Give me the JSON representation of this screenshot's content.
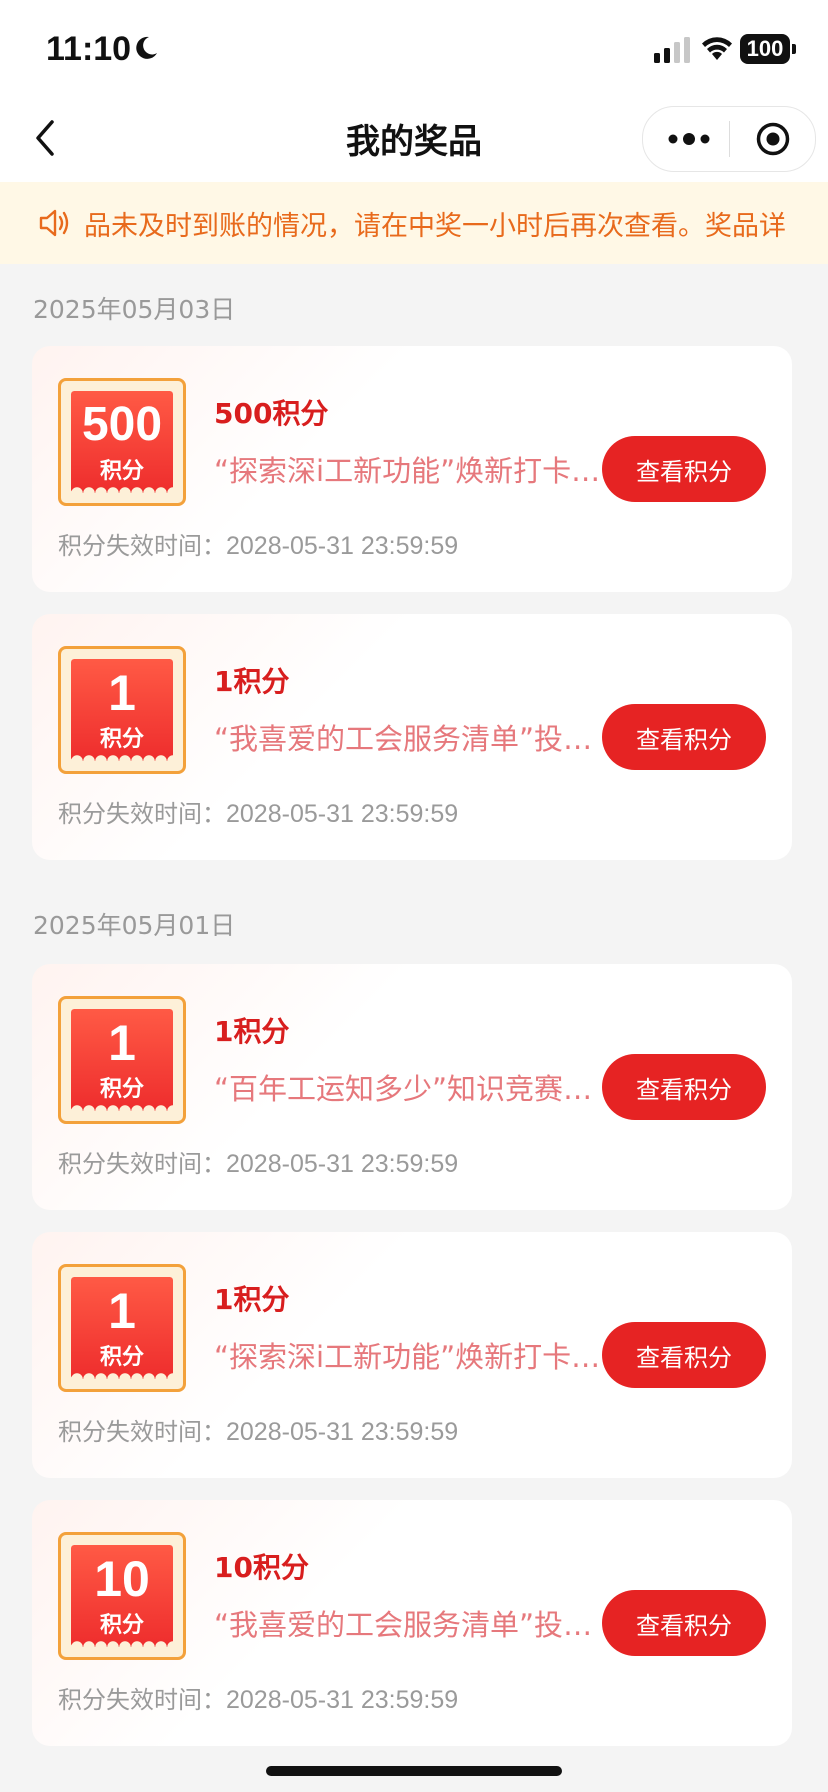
{
  "status_bar": {
    "time": "11:10",
    "battery": "100"
  },
  "nav": {
    "title": "我的奖品"
  },
  "notice": {
    "text": "品未及时到账的情况，请在中奖一小时后再次查看。奖品详"
  },
  "groups": [
    {
      "date": "2025年05月03日",
      "items": [
        {
          "badge_value": "500",
          "badge_unit": "积分",
          "name": "500积分",
          "description": "“探索深i工新功能”焕新打卡活动",
          "button_label": "查看积分",
          "expire_label": "积分失效时间：",
          "expire_value": "2028-05-31 23:59:59"
        },
        {
          "badge_value": "1",
          "badge_unit": "积分",
          "name": "1积分",
          "description": "“我喜爱的工会服务清单”投票活动",
          "button_label": "查看积分",
          "expire_label": "积分失效时间：",
          "expire_value": "2028-05-31 23:59:59"
        }
      ]
    },
    {
      "date": "2025年05月01日",
      "items": [
        {
          "badge_value": "1",
          "badge_unit": "积分",
          "name": "1积分",
          "description": "“百年工运知多少”知识竞赛活动",
          "button_label": "查看积分",
          "expire_label": "积分失效时间：",
          "expire_value": "2028-05-31 23:59:59"
        },
        {
          "badge_value": "1",
          "badge_unit": "积分",
          "name": "1积分",
          "description": "“探索深i工新功能”焕新打卡活动",
          "button_label": "查看积分",
          "expire_label": "积分失效时间：",
          "expire_value": "2028-05-31 23:59:59"
        },
        {
          "badge_value": "10",
          "badge_unit": "积分",
          "name": "10积分",
          "description": "“我喜爱的工会服务清单”投票活动",
          "button_label": "查看积分",
          "expire_label": "积分失效时间：",
          "expire_value": "2028-05-31 23:59:59"
        }
      ]
    }
  ],
  "colors": {
    "accent_red": "#e62323",
    "notice_bg": "#fff8e6",
    "notice_text": "#e86a1c",
    "badge_border": "#f3a13b"
  },
  "icons": {
    "status": [
      "moon-icon",
      "cellular-signal-icon",
      "wifi-icon",
      "battery-icon"
    ],
    "nav": [
      "back-arrow-icon",
      "more-dots-icon",
      "target-circle-icon"
    ],
    "notice": "speaker-icon"
  }
}
